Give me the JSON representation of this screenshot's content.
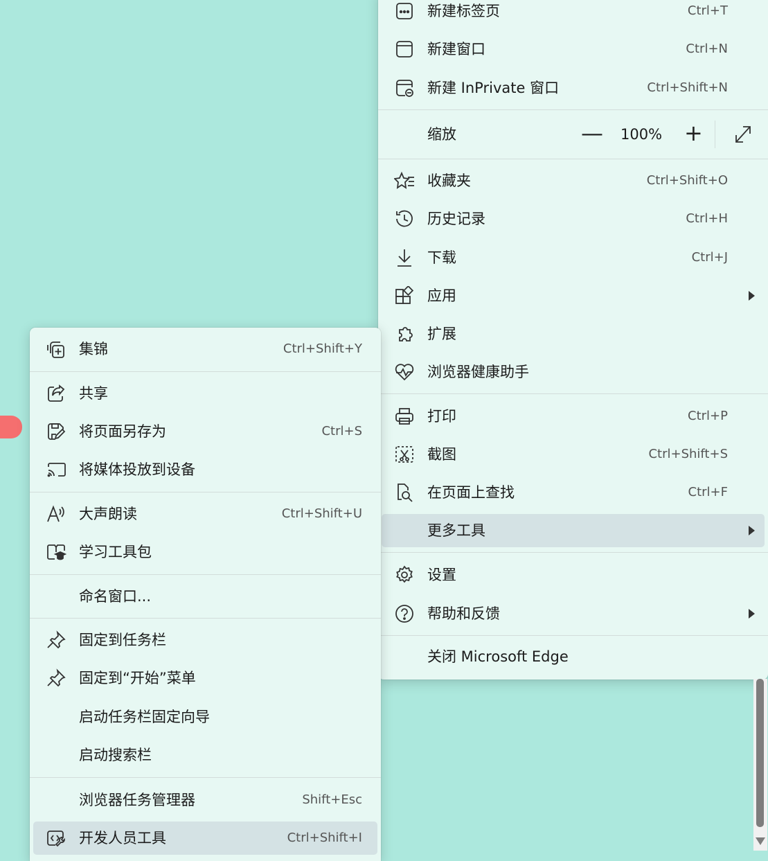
{
  "main_menu": {
    "new_tab": {
      "label": "新建标签页",
      "shortcut": "Ctrl+T"
    },
    "new_window": {
      "label": "新建窗口",
      "shortcut": "Ctrl+N"
    },
    "new_inprivate": {
      "label": "新建 InPrivate 窗口",
      "shortcut": "Ctrl+Shift+N"
    },
    "zoom": {
      "label": "缩放",
      "minus": "—",
      "value": "100%",
      "plus": "+"
    },
    "favorites": {
      "label": "收藏夹",
      "shortcut": "Ctrl+Shift+O"
    },
    "history": {
      "label": "历史记录",
      "shortcut": "Ctrl+H"
    },
    "downloads": {
      "label": "下载",
      "shortcut": "Ctrl+J"
    },
    "apps": {
      "label": "应用"
    },
    "extensions": {
      "label": "扩展"
    },
    "browser_health": {
      "label": "浏览器健康助手"
    },
    "print": {
      "label": "打印",
      "shortcut": "Ctrl+P"
    },
    "screenshot": {
      "label": "截图",
      "shortcut": "Ctrl+Shift+S"
    },
    "find_on_page": {
      "label": "在页面上查找",
      "shortcut": "Ctrl+F"
    },
    "more_tools": {
      "label": "更多工具"
    },
    "settings": {
      "label": "设置"
    },
    "help_feedback": {
      "label": "帮助和反馈"
    },
    "close_edge": {
      "label": "关闭 Microsoft Edge"
    }
  },
  "more_tools_menu": {
    "collections": {
      "label": "集锦",
      "shortcut": "Ctrl+Shift+Y"
    },
    "share": {
      "label": "共享"
    },
    "save_page_as": {
      "label": "将页面另存为",
      "shortcut": "Ctrl+S"
    },
    "cast_media": {
      "label": "将媒体投放到设备"
    },
    "read_aloud": {
      "label": "大声朗读",
      "shortcut": "Ctrl+Shift+U"
    },
    "learning_toolkit": {
      "label": "学习工具包"
    },
    "name_window": {
      "label": "命名窗口..."
    },
    "pin_taskbar": {
      "label": "固定到任务栏"
    },
    "pin_start": {
      "label": "固定到“开始”菜单"
    },
    "taskbar_pin_wizard": {
      "label": "启动任务栏固定向导"
    },
    "search_bar": {
      "label": "启动搜索栏"
    },
    "task_manager": {
      "label": "浏览器任务管理器",
      "shortcut": "Shift+Esc"
    },
    "dev_tools": {
      "label": "开发人员工具",
      "shortcut": "Ctrl+Shift+I"
    }
  },
  "colors": {
    "background": "#ace8dd",
    "menu": "#e7f8f3",
    "selected": "#d4e2e4",
    "tab_accent": "#f56f6f"
  }
}
